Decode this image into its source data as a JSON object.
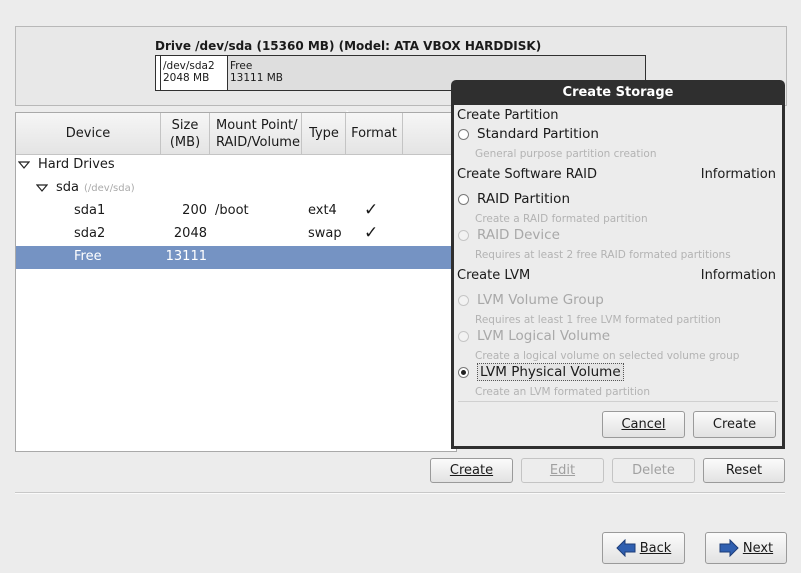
{
  "drive": {
    "title": "Drive /dev/sda (15360 MB) (Model: ATA VBOX HARDDISK)",
    "segments": [
      {
        "name": "/dev/sda2",
        "size": "2048 MB"
      },
      {
        "name": "Free",
        "size": "13111 MB"
      }
    ]
  },
  "table": {
    "headers": {
      "device": "Device",
      "size_1": "Size",
      "size_2": "(MB)",
      "mount_1": "Mount Point/",
      "mount_2": "RAID/Volume",
      "type": "Type",
      "format": "Format"
    },
    "tree": {
      "hard_drives": "Hard Drives",
      "sda": "sda",
      "sda_path": "(/dev/sda)",
      "rows": [
        {
          "device": "sda1",
          "size": "200",
          "mount": "/boot",
          "type": "ext4",
          "format": "✓"
        },
        {
          "device": "sda2",
          "size": "2048",
          "mount": "",
          "type": "swap",
          "format": "✓"
        },
        {
          "device": "Free",
          "size": "13111",
          "mount": "",
          "type": "",
          "format": ""
        }
      ]
    }
  },
  "actions": {
    "create": "Create",
    "edit": "Edit",
    "delete": "Delete",
    "reset": "Reset"
  },
  "nav": {
    "back": "Back",
    "next": "Next"
  },
  "dialog": {
    "title": "Create Storage",
    "create_partition": "Create Partition",
    "standard_partition": "Standard Partition",
    "standard_partition_desc": "General purpose partition creation",
    "create_software_raid": "Create Software RAID",
    "information_1": "Information",
    "raid_partition": "RAID Partition",
    "raid_partition_desc": "Create a RAID formated partition",
    "raid_device": "RAID Device",
    "raid_device_desc": "Requires at least 2 free RAID formated partitions",
    "create_lvm": "Create LVM",
    "information_2": "Information",
    "lvm_volume_group": "LVM Volume Group",
    "lvm_volume_group_desc": "Requires at least 1 free LVM formated partition",
    "lvm_logical_volume": "LVM Logical Volume",
    "lvm_logical_volume_desc": "Create a logical volume on selected volume group",
    "lvm_physical_volume": "LVM Physical Volume",
    "lvm_physical_volume_desc": "Create an LVM formated partition",
    "cancel": "Cancel",
    "create": "Create",
    "selected_option": "LVM Physical Volume"
  },
  "colors": {
    "selection": "#7593c3",
    "dialog_frame": "#2f2f2f",
    "back_arrow": "#2f5fb0"
  }
}
